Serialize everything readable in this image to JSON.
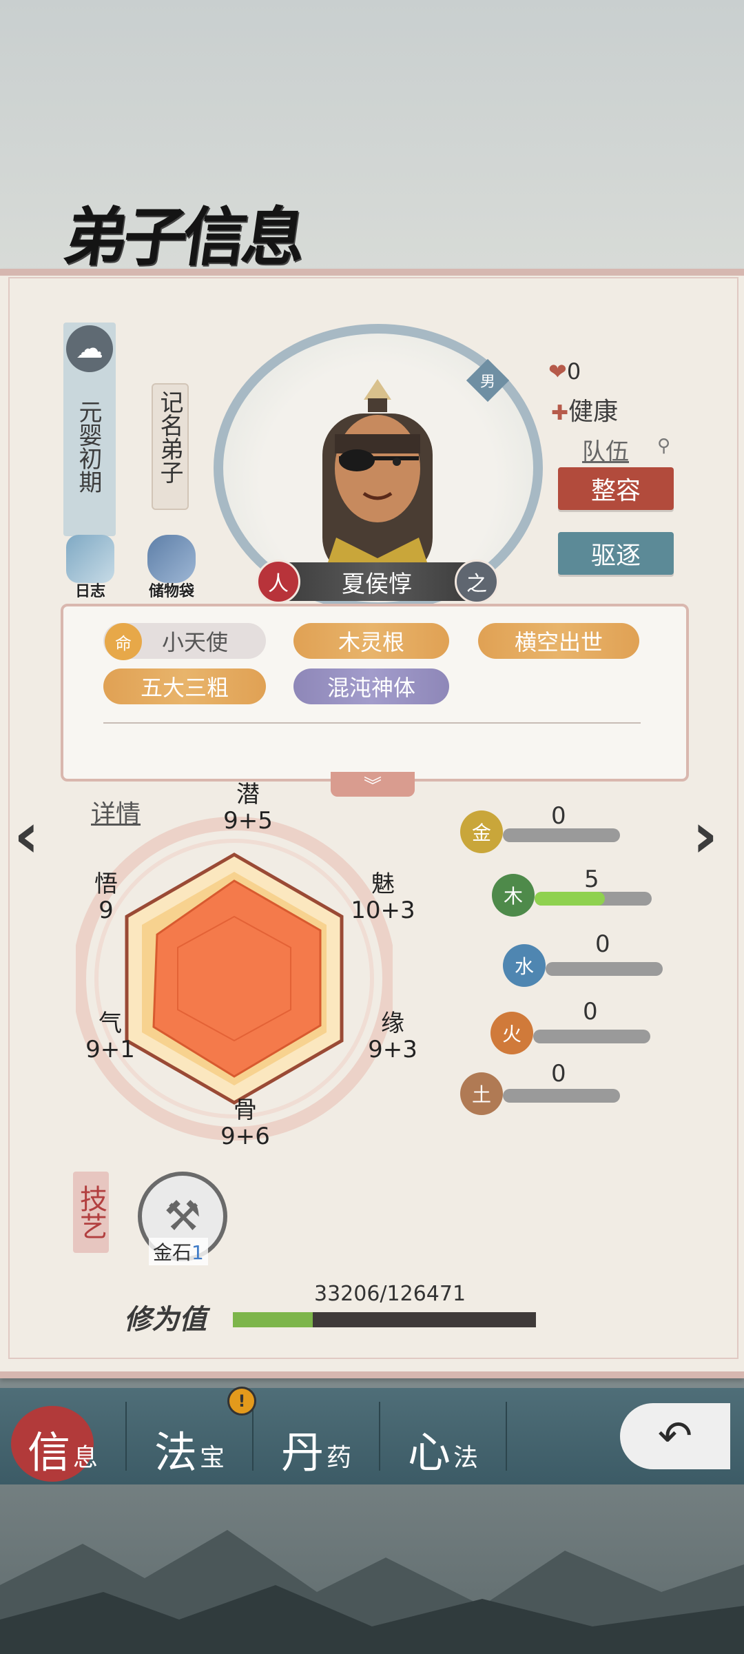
{
  "header": {
    "title": "弟子信息"
  },
  "profile": {
    "realm": "元婴初期",
    "rank": "记名弟子",
    "gender": "男",
    "name": "夏侯惇",
    "name_left_badge": "人",
    "name_right_badge": "之",
    "count": "0",
    "health": "健康",
    "team": "队伍"
  },
  "actions": {
    "log": "日志",
    "storage": "储物袋",
    "style": "整容",
    "expel": "驱逐"
  },
  "traits": [
    {
      "label": "小天使",
      "style": "plain"
    },
    {
      "label": "木灵根",
      "style": "gold"
    },
    {
      "label": "横空出世",
      "style": "gold"
    },
    {
      "label": "五大三粗",
      "style": "gold"
    },
    {
      "label": "混沌神体",
      "style": "purple"
    }
  ],
  "trait_badge": "命",
  "details_label": "详情",
  "radar": {
    "stats": [
      {
        "name": "潜",
        "value": "9+5"
      },
      {
        "name": "魅",
        "value": "10+3"
      },
      {
        "name": "缘",
        "value": "9+3"
      },
      {
        "name": "骨",
        "value": "9+6"
      },
      {
        "name": "气",
        "value": "9+1"
      },
      {
        "name": "悟",
        "value": "9"
      }
    ]
  },
  "elements": [
    {
      "glyph": "金",
      "value": "0",
      "fraction": 0,
      "color": "#c9a63a"
    },
    {
      "glyph": "木",
      "value": "5",
      "fraction": 0.6,
      "color": "#4e8a4a"
    },
    {
      "glyph": "水",
      "value": "0",
      "fraction": 0,
      "color": "#4f86b1"
    },
    {
      "glyph": "火",
      "value": "0",
      "fraction": 0,
      "color": "#d07a3a"
    },
    {
      "glyph": "土",
      "value": "0",
      "fraction": 0,
      "color": "#b07a54"
    }
  ],
  "skills": {
    "tag": "技艺",
    "name": "金石",
    "level": "1"
  },
  "cultivation": {
    "label": "修为值",
    "value": "33206/126471",
    "fraction": 0.2626
  },
  "tabs": [
    {
      "big": "信",
      "small": "息",
      "active": true
    },
    {
      "big": "法",
      "small": "宝"
    },
    {
      "big": "丹",
      "small": "药"
    },
    {
      "big": "心",
      "small": "法"
    }
  ],
  "alert": "!"
}
